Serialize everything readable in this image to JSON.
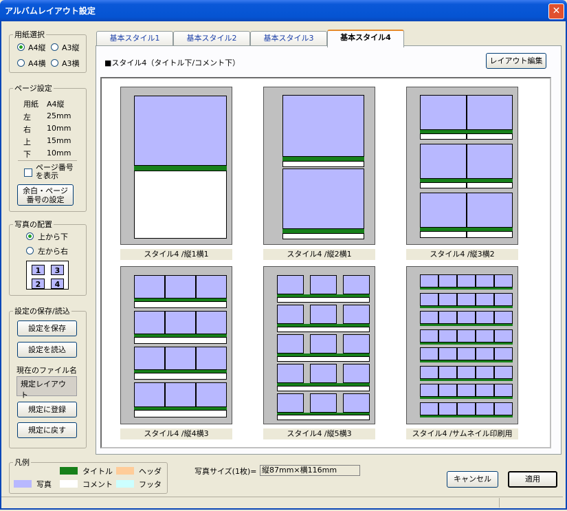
{
  "window": {
    "title": "アルバムレイアウト設定",
    "close_symbol": "✕"
  },
  "paper": {
    "legend": "用紙選択",
    "options": [
      "A4縦",
      "A3縦",
      "A4横",
      "A3横"
    ],
    "selected": "A4縦"
  },
  "page_settings": {
    "legend": "ページ設定",
    "rows": [
      {
        "label": "用紙",
        "value": "A4縦"
      },
      {
        "label": "左",
        "value": "25mm"
      },
      {
        "label": "右",
        "value": "10mm"
      },
      {
        "label": "上",
        "value": "15mm"
      },
      {
        "label": "下",
        "value": "10mm"
      }
    ],
    "show_page_number": {
      "line1": "ページ番号",
      "line2": "を表示",
      "checked": false
    },
    "margin_button": {
      "line1": "余白・ページ",
      "line2": "番号の設定"
    }
  },
  "photo_order": {
    "legend": "写真の配置",
    "options": [
      "上から下",
      "左から右"
    ],
    "selected": "上から下",
    "grid": [
      "1",
      "3",
      "2",
      "4"
    ]
  },
  "save_load": {
    "legend": "設定の保存/読込",
    "save": "設定を保存",
    "load": "設定を読込",
    "filename_label": "現在のファイル名",
    "filename": "規定レイアウト",
    "register": "規定に登録",
    "restore": "規定に戻す"
  },
  "tabs": [
    "基本スタイル1",
    "基本スタイル2",
    "基本スタイル3",
    "基本スタイル4"
  ],
  "active_tab": "基本スタイル4",
  "heading": "■スタイル4（タイトル下/コメント下）",
  "edit_button": "レイアウト編集",
  "layouts": [
    "スタイル4 /縦1横1",
    "スタイル4 /縦2横1",
    "スタイル4 /縦3横2",
    "スタイル4 /縦4横3",
    "スタイル4 /縦5横3",
    "スタイル4 /サムネイル印刷用"
  ],
  "legend_box": {
    "legend": "凡例",
    "items": [
      {
        "label": "タイトル",
        "color": "#17801a"
      },
      {
        "label": "ヘッダ",
        "color": "#ffcc99"
      },
      {
        "label": "写真",
        "color": "#b8b8ff"
      },
      {
        "label": "コメント",
        "color": "#ffffff"
      },
      {
        "label": "フッタ",
        "color": "#ccffff"
      }
    ]
  },
  "photo_size": {
    "label": "写真サイズ(1枚)=",
    "value": "縦87mm×横116mm"
  },
  "buttons": {
    "cancel": "キャンセル",
    "apply": "適用"
  }
}
